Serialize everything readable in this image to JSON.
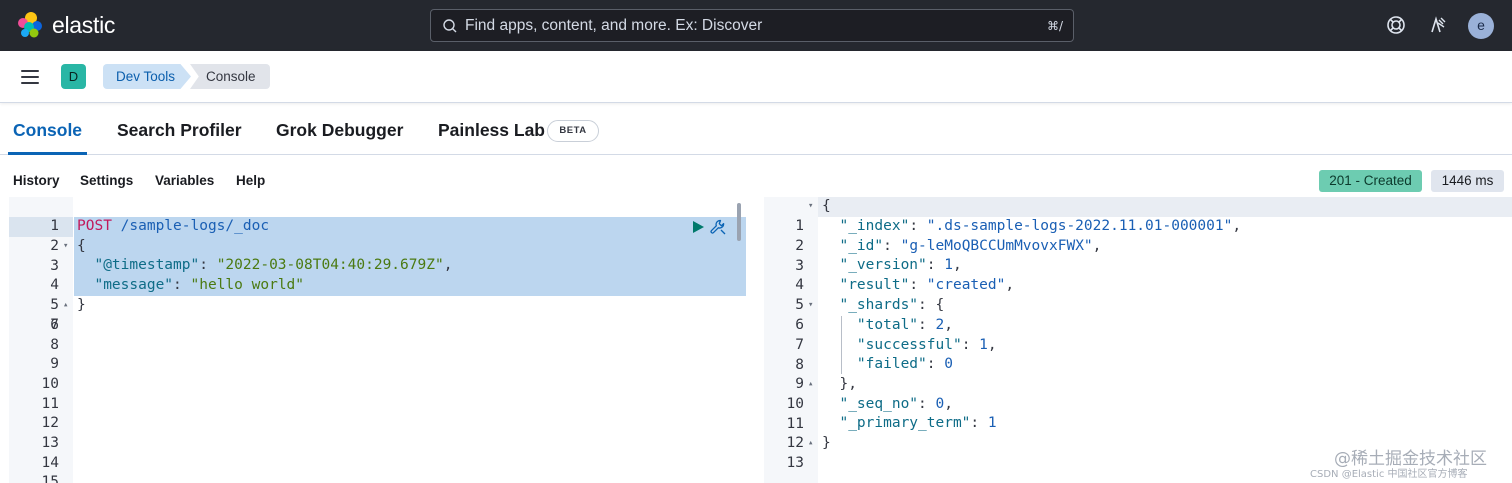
{
  "header": {
    "brand": "elastic",
    "search_placeholder": "Find apps, content, and more. Ex: Discover",
    "search_shortcut": "⌘/",
    "avatar_letter": "e"
  },
  "nav": {
    "space_letter": "D",
    "breadcrumbs": [
      "Dev Tools",
      "Console"
    ]
  },
  "tabs": {
    "items": [
      "Console",
      "Search Profiler",
      "Grok Debugger",
      "Painless Lab"
    ],
    "active": "Console",
    "beta_label": "BETA"
  },
  "toolbar": {
    "items": [
      "History",
      "Settings",
      "Variables",
      "Help"
    ],
    "status": "201 - Created",
    "duration": "1446 ms"
  },
  "request": {
    "line_numbers": [
      "1",
      "2",
      "3",
      "4",
      "5",
      "6",
      "7",
      "8",
      "9",
      "10",
      "11",
      "12",
      "13",
      "14",
      "15"
    ],
    "method": "POST",
    "path": "/sample-logs/_doc",
    "open_brace": "{",
    "timestamp_key": "\"@timestamp\"",
    "timestamp_value": "\"2022-03-08T04:40:29.679Z\"",
    "message_key": "\"message\"",
    "message_value": "\"hello world\"",
    "close_brace": "}"
  },
  "response": {
    "line_numbers": [
      "1",
      "2",
      "3",
      "4",
      "5",
      "6",
      "7",
      "8",
      "9",
      "10",
      "11",
      "12",
      "13"
    ],
    "index_key": "\"_index\"",
    "index_value": "\".ds-sample-logs-2022.11.01-000001\"",
    "id_key": "\"_id\"",
    "id_value": "\"g-leMoQBCCUmMvovxFWX\"",
    "version_key": "\"_version\"",
    "version_value": "1",
    "result_key": "\"result\"",
    "result_value": "\"created\"",
    "shards_key": "\"_shards\"",
    "total_key": "\"total\"",
    "total_value": "2",
    "successful_key": "\"successful\"",
    "successful_value": "1",
    "failed_key": "\"failed\"",
    "failed_value": "0",
    "seq_no_key": "\"_seq_no\"",
    "seq_no_value": "0",
    "primary_term_key": "\"_primary_term\"",
    "primary_term_value": "1"
  },
  "watermark": {
    "line1": "@稀土掘金技术社区",
    "line2": "CSDN @Elastic 中国社区官方博客"
  },
  "colors": {
    "header_bg": "#25282f",
    "accent": "#0b64b5",
    "status_green": "#6dccb1",
    "selection": "#bcd6ef"
  }
}
